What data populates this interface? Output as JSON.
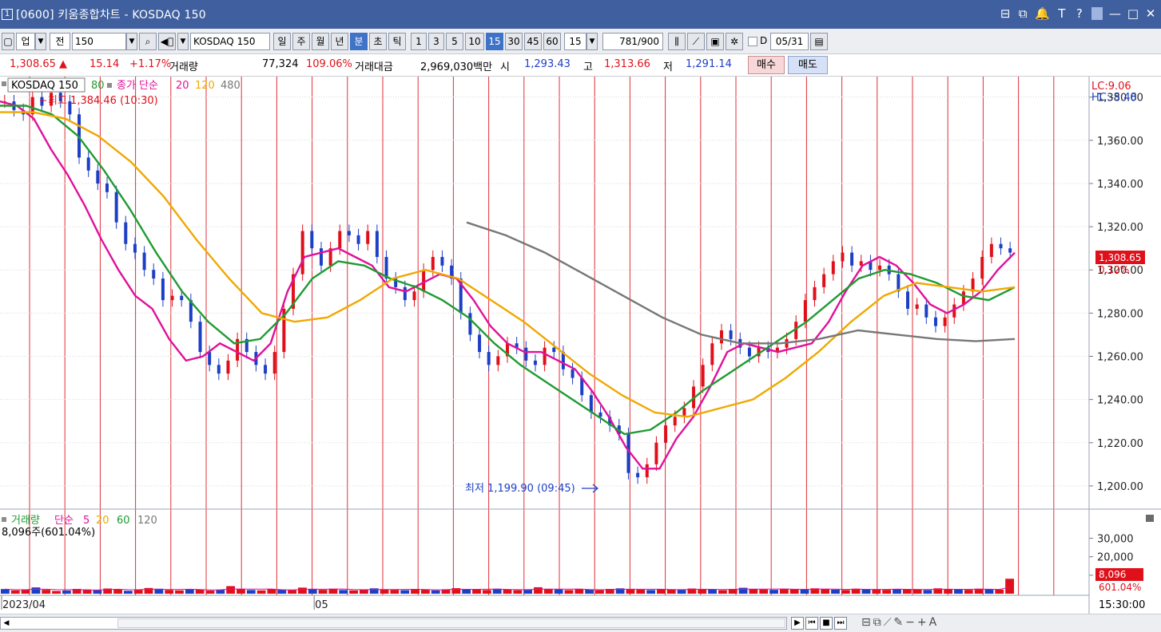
{
  "window": {
    "icon_label": "1",
    "title": "[0600] 키움종합차트 - KOSDAQ 150",
    "controls": [
      "⊟",
      "⧉",
      "🔔",
      "T",
      "?",
      "—",
      "□",
      "✕"
    ]
  },
  "toolbar": {
    "market": "업",
    "prev": "전",
    "code": "150",
    "search_icon": "search-icon",
    "speaker_icon": "speaker-icon",
    "name": "KOSDAQ 150",
    "period_buttons": [
      "일",
      "주",
      "월",
      "년",
      "분",
      "초",
      "틱"
    ],
    "minute_buttons": [
      "1",
      "3",
      "5",
      "10",
      "15",
      "30",
      "45",
      "60"
    ],
    "selected_period": "분",
    "selected_minute": "15",
    "interval_value": "15",
    "count_value": "781",
    "count_total": "/900",
    "tool_icons": [
      "candle-settings-icon",
      "indicator-icon",
      "save-icon",
      "gear-icon"
    ],
    "checkbox_label": "D",
    "date": "05/31",
    "calendar_icon": "calendar-icon"
  },
  "infobar": {
    "price": "1,308.65",
    "arrow": "▲",
    "change": "15.14",
    "change_pct": "+1.17%",
    "volume_label": "거래량",
    "volume": "77,324",
    "volume_pct": "109.06%",
    "amount_label": "거래대금",
    "amount": "2,969,030백만",
    "open_label": "시",
    "open": "1,293.43",
    "high_label": "고",
    "high": "1,313.66",
    "low_label": "저",
    "low": "1,291.14",
    "buy": "매수",
    "sell": "매도"
  },
  "chart_data": {
    "type": "candlestick",
    "price_panel": {
      "legend": {
        "name": "KOSDAQ 150",
        "n80": "80",
        "label": "종가 단순",
        "n20": "20",
        "n120": "120",
        "n480": "480"
      },
      "lc_label": "LC:9.06",
      "hc_label": "HC:-5.48",
      "high_annotation": "최고 1,384.46 (10:30)",
      "low_annotation": "최저 1,199.90 (09:45)",
      "current_price": "1,308.65",
      "current_pct": "0.12%",
      "ylim": [
        1190,
        1388
      ],
      "y_ticks": [
        {
          "v": 1380,
          "label": "1,380.00"
        },
        {
          "v": 1360,
          "label": "1,360.00"
        },
        {
          "v": 1340,
          "label": "1,340.00"
        },
        {
          "v": 1320,
          "label": "1,320.00"
        },
        {
          "v": 1300,
          "label": "1,300.00"
        },
        {
          "v": 1280,
          "label": "1,280.00"
        },
        {
          "v": 1260,
          "label": "1,260.00"
        },
        {
          "v": 1240,
          "label": "1,240.00"
        },
        {
          "v": 1220,
          "label": "1,220.00"
        },
        {
          "v": 1200,
          "label": "1,200.00"
        }
      ],
      "close_series": [
        1378,
        1374,
        1372,
        1380,
        1376,
        1382,
        1378,
        1372,
        1352,
        1346,
        1340,
        1336,
        1322,
        1312,
        1308,
        1300,
        1296,
        1286,
        1288,
        1286,
        1276,
        1262,
        1256,
        1252,
        1258,
        1268,
        1262,
        1256,
        1252,
        1262,
        1282,
        1298,
        1318,
        1310,
        1302,
        1310,
        1318,
        1316,
        1312,
        1318,
        1306,
        1296,
        1292,
        1286,
        1290,
        1300,
        1306,
        1302,
        1296,
        1280,
        1270,
        1262,
        1256,
        1260,
        1266,
        1264,
        1258,
        1256,
        1264,
        1262,
        1254,
        1250,
        1242,
        1234,
        1232,
        1228,
        1224,
        1206,
        1204,
        1210,
        1220,
        1228,
        1232,
        1236,
        1246,
        1256,
        1266,
        1272,
        1268,
        1264,
        1260,
        1264,
        1262,
        1264,
        1268,
        1276,
        1286,
        1292,
        1298,
        1304,
        1308,
        1302,
        1304,
        1300,
        1302,
        1298,
        1290,
        1282,
        1284,
        1278,
        1274,
        1278,
        1284,
        1290,
        1296,
        1306,
        1312,
        1310,
        1308
      ],
      "ma_series": [
        {
          "name": "20",
          "color": "#e0119a",
          "values": [
            1378,
            1376,
            1370,
            1356,
            1344,
            1330,
            1314,
            1300,
            1288,
            1282,
            1268,
            1258,
            1260,
            1266,
            1262,
            1258,
            1266,
            1290,
            1306,
            1308,
            1310,
            1306,
            1302,
            1292,
            1290,
            1294,
            1298,
            1296,
            1286,
            1274,
            1266,
            1262,
            1262,
            1258,
            1254,
            1244,
            1232,
            1218,
            1208,
            1208,
            1222,
            1232,
            1246,
            1262,
            1266,
            1264,
            1262,
            1264,
            1266,
            1276,
            1290,
            1302,
            1306,
            1302,
            1294,
            1284,
            1280,
            1284,
            1290,
            1300,
            1308
          ]
        },
        {
          "name": "80",
          "color": "#1f9b32",
          "values": [
            1376,
            1376,
            1372,
            1362,
            1346,
            1328,
            1308,
            1290,
            1276,
            1266,
            1268,
            1280,
            1296,
            1304,
            1302,
            1296,
            1292,
            1286,
            1278,
            1266,
            1256,
            1248,
            1240,
            1232,
            1224,
            1226,
            1234,
            1244,
            1252,
            1260,
            1268,
            1276,
            1286,
            1296,
            1300,
            1298,
            1294,
            1288,
            1286,
            1292
          ]
        },
        {
          "name": "120",
          "color": "#f0a800",
          "values": [
            1373,
            1373,
            1370,
            1362,
            1350,
            1334,
            1314,
            1296,
            1280,
            1276,
            1278,
            1286,
            1296,
            1300,
            1296,
            1286,
            1276,
            1264,
            1252,
            1242,
            1234,
            1232,
            1236,
            1240,
            1250,
            1262,
            1276,
            1288,
            1294,
            1292,
            1290,
            1292
          ]
        },
        {
          "name": "480",
          "color": "#777777",
          "values": [
            1322,
            1316,
            1308,
            1298,
            1288,
            1278,
            1270,
            1266,
            1266,
            1268,
            1272,
            1270,
            1268,
            1267,
            1268
          ]
        }
      ]
    },
    "volume_panel": {
      "legend": {
        "label": "거래량",
        "simple": "단순",
        "n5": "5",
        "n20": "20",
        "n60": "60",
        "n120": "120"
      },
      "readout": "8,096주(601.04%)",
      "current_value": "8,096",
      "current_pct": "601.04%",
      "ylim": [
        0,
        38000
      ],
      "y_ticks": [
        {
          "v": 30000,
          "label": "30,000"
        },
        {
          "v": 20000,
          "label": "20,000"
        },
        {
          "v": 10000,
          "label": "10,000"
        }
      ],
      "bars": [
        2500,
        1800,
        2200,
        3400,
        2100,
        1500,
        1700,
        2600,
        2300,
        1900,
        2800,
        2400,
        1600,
        2100,
        3100,
        2700,
        2000,
        1800,
        2500,
        2300,
        1700,
        2200,
        4100,
        2500,
        2000,
        1800,
        2400,
        2200,
        1900,
        3300,
        2600,
        2100,
        2700,
        2000,
        1800,
        2300,
        2900,
        2400,
        2100,
        1900,
        2600,
        2200,
        1800,
        2400,
        3000,
        2500,
        2200,
        2000,
        2700,
        2300,
        1900,
        2100,
        3500,
        2600,
        2300,
        2000,
        2400,
        2200,
        1900,
        2600,
        2900,
        2400,
        2200,
        2000,
        2500,
        2300,
        2100,
        2800,
        2400,
        2200,
        1900,
        2600,
        3200,
        2500,
        2300,
        2100,
        2700,
        2500,
        2200,
        2900,
        2400,
        2200,
        2000,
        2700,
        2500,
        2300,
        2100,
        2600,
        2400,
        2200,
        2000,
        2900,
        2500,
        2300,
        2100,
        2700,
        2400,
        2200,
        8096
      ]
    },
    "x_labels": [
      {
        "pos": 0.0,
        "label": "2023/04"
      },
      {
        "pos": 0.287,
        "label": "05"
      }
    ],
    "time_label": "15:30:00",
    "session_lines": 31
  },
  "statusbar": {
    "nav_buttons": [
      "▶",
      "⏮",
      "■",
      "⏭"
    ],
    "tool_icons": [
      "zoom-fit-icon",
      "layout-icon",
      "trend-icon",
      "draw-icon",
      "zoom-out-icon",
      "zoom-in-icon",
      "text-icon"
    ]
  }
}
